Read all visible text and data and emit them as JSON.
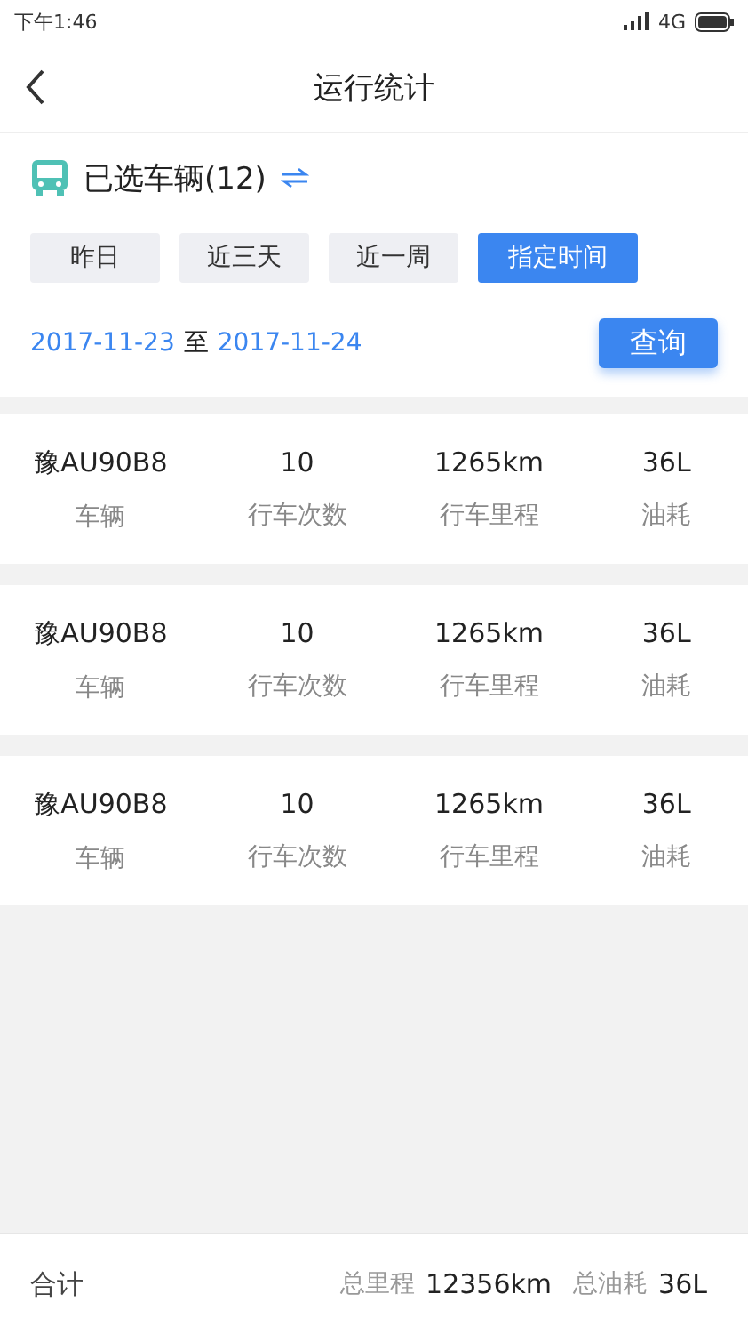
{
  "status_bar": {
    "time": "下午1:46",
    "network": "4G"
  },
  "nav": {
    "title": "运行统计"
  },
  "vehicle_selector": {
    "label": "已选车辆(12)"
  },
  "range_tabs": [
    {
      "label": "昨日",
      "selected": false
    },
    {
      "label": "近三天",
      "selected": false
    },
    {
      "label": "近一周",
      "selected": false
    },
    {
      "label": "指定时间",
      "selected": true
    }
  ],
  "date_range": {
    "start": "2017-11-23",
    "separator": "至",
    "end": "2017-11-24"
  },
  "query_button": "查询",
  "records": [
    {
      "cells": [
        {
          "value": "豫AU90B8",
          "label": "车辆"
        },
        {
          "value": "10",
          "label": "行车次数"
        },
        {
          "value": "1265km",
          "label": "行车里程"
        },
        {
          "value": "36L",
          "label": "油耗"
        }
      ]
    },
    {
      "cells": [
        {
          "value": "豫AU90B8",
          "label": "车辆"
        },
        {
          "value": "10",
          "label": "行车次数"
        },
        {
          "value": "1265km",
          "label": "行车里程"
        },
        {
          "value": "36L",
          "label": "油耗"
        }
      ]
    },
    {
      "cells": [
        {
          "value": "豫AU90B8",
          "label": "车辆"
        },
        {
          "value": "10",
          "label": "行车次数"
        },
        {
          "value": "1265km",
          "label": "行车里程"
        },
        {
          "value": "36L",
          "label": "油耗"
        }
      ]
    }
  ],
  "footer": {
    "title": "合计",
    "totals": [
      {
        "label": "总里程",
        "value": "12356km"
      },
      {
        "label": "总油耗",
        "value": "36L"
      }
    ]
  }
}
